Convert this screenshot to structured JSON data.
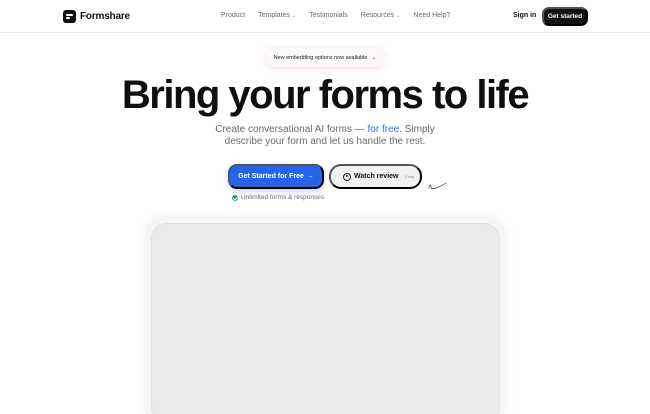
{
  "brand": {
    "name": "Formshare"
  },
  "nav": {
    "items": [
      {
        "label": "Product",
        "has_caret": false
      },
      {
        "label": "Templates",
        "has_caret": true
      },
      {
        "label": "Testimonials",
        "has_caret": false
      },
      {
        "label": "Resources",
        "has_caret": true
      },
      {
        "label": "Need Help?",
        "has_caret": false
      }
    ],
    "signin_label": "Sign in",
    "cta_label": "Get started"
  },
  "badge": {
    "text": "New embedding options now available",
    "arrow": "→"
  },
  "hero": {
    "title": "Bring your forms to life",
    "subtitle_part1": "Create conversational AI forms — ",
    "subtitle_highlight": "for free",
    "subtitle_part2": ". Simply",
    "subtitle_line2": "describe your form and let us handle the rest.",
    "primary_cta": "Get Started for Free",
    "primary_arrow": "→",
    "secondary_cta": "Watch review",
    "secondary_duration": "2 min",
    "note": "Unlimited forms & responses"
  },
  "colors": {
    "accent": "#2563eb",
    "highlight_text": "#2f6fe9",
    "dark": "#111111",
    "check_green": "#22a06b"
  },
  "icons": [
    "logo-icon",
    "chevron-down-icon",
    "arrow-right-icon",
    "play-circle-icon",
    "check-circle-icon",
    "squiggle-arrow-icon"
  ]
}
